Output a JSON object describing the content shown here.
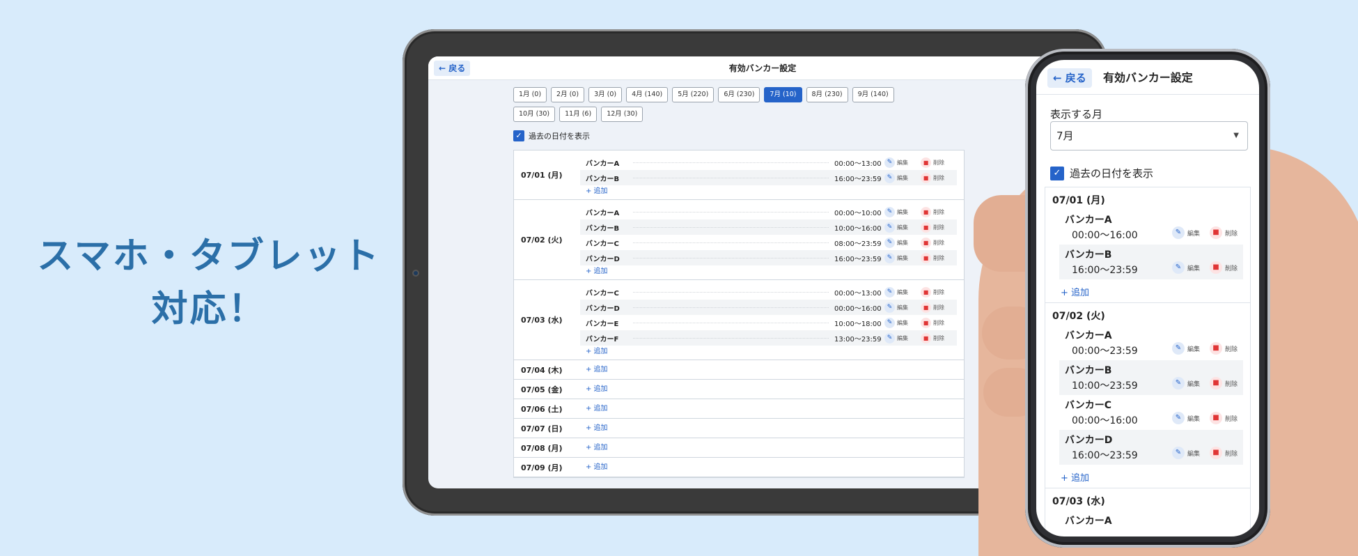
{
  "headline": {
    "line1": "スマホ・タブレット",
    "line2": "対応！"
  },
  "tablet": {
    "back_label": "← 戻る",
    "title": "有効バンカー設定",
    "months": [
      {
        "label": "1月 (0)",
        "active": false
      },
      {
        "label": "2月 (0)",
        "active": false
      },
      {
        "label": "3月 (0)",
        "active": false
      },
      {
        "label": "4月 (140)",
        "active": false
      },
      {
        "label": "5月 (220)",
        "active": false
      },
      {
        "label": "6月 (230)",
        "active": false
      },
      {
        "label": "7月 (10)",
        "active": true
      },
      {
        "label": "8月 (230)",
        "active": false
      },
      {
        "label": "9月 (140)",
        "active": false
      },
      {
        "label": "10月 (30)",
        "active": false
      },
      {
        "label": "11月 (6)",
        "active": false
      },
      {
        "label": "12月 (30)",
        "active": false
      }
    ],
    "show_past_label": "過去の日付を表示",
    "edit_label": "編集",
    "delete_label": "削除",
    "add_label": "+ 追加",
    "days": [
      {
        "date": "07/01 (月)",
        "entries": [
          {
            "name": "バンカーA",
            "time": "00:00〜13:00"
          },
          {
            "name": "バンカーB",
            "time": "16:00〜23:59"
          }
        ]
      },
      {
        "date": "07/02 (火)",
        "entries": [
          {
            "name": "バンカーA",
            "time": "00:00〜10:00"
          },
          {
            "name": "バンカーB",
            "time": "10:00〜16:00"
          },
          {
            "name": "バンカーC",
            "time": "08:00〜23:59"
          },
          {
            "name": "バンカーD",
            "time": "16:00〜23:59"
          }
        ]
      },
      {
        "date": "07/03 (水)",
        "entries": [
          {
            "name": "バンカーC",
            "time": "00:00〜13:00"
          },
          {
            "name": "バンカーD",
            "time": "00:00〜16:00"
          },
          {
            "name": "バンカーE",
            "time": "10:00〜18:00"
          },
          {
            "name": "バンカーF",
            "time": "13:00〜23:59"
          }
        ]
      },
      {
        "date": "07/04 (木)",
        "entries": []
      },
      {
        "date": "07/05 (金)",
        "entries": []
      },
      {
        "date": "07/06 (土)",
        "entries": []
      },
      {
        "date": "07/07 (日)",
        "entries": []
      },
      {
        "date": "07/08 (月)",
        "entries": []
      },
      {
        "date": "07/09 (月)",
        "entries": []
      }
    ]
  },
  "phone": {
    "back_label": "← 戻る",
    "title": "有効バンカー設定",
    "month_label": "表示する月",
    "month_value": "7月",
    "show_past_label": "過去の日付を表示",
    "edit_label": "編集",
    "delete_label": "削除",
    "add_label": "+ 追加",
    "days": [
      {
        "date": "07/01 (月)",
        "entries": [
          {
            "name": "バンカーA",
            "time": "00:00〜16:00"
          },
          {
            "name": "バンカーB",
            "time": "16:00〜23:59"
          }
        ]
      },
      {
        "date": "07/02 (火)",
        "entries": [
          {
            "name": "バンカーA",
            "time": "00:00〜23:59"
          },
          {
            "name": "バンカーB",
            "time": "10:00〜23:59"
          },
          {
            "name": "バンカーC",
            "time": "00:00〜16:00"
          },
          {
            "name": "バンカーD",
            "time": "16:00〜23:59"
          }
        ]
      },
      {
        "date": "07/03 (水)",
        "entries": [
          {
            "name": "バンカーA",
            "time": ""
          }
        ]
      }
    ]
  }
}
